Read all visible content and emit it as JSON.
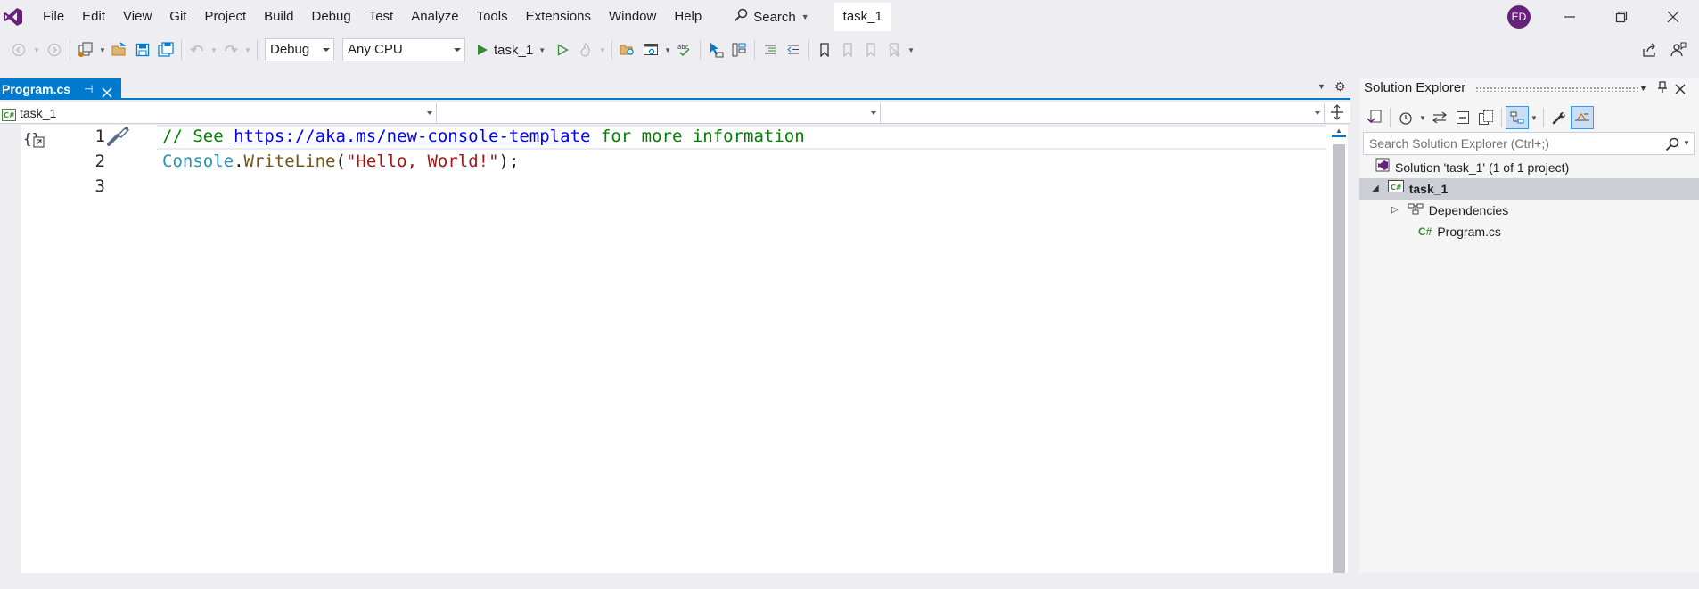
{
  "menu": {
    "items": [
      "File",
      "Edit",
      "View",
      "Git",
      "Project",
      "Build",
      "Debug",
      "Test",
      "Analyze",
      "Tools",
      "Extensions",
      "Window",
      "Help"
    ],
    "search_label": "Search",
    "title_tab": "task_1",
    "avatar_initials": "ED"
  },
  "toolbar": {
    "configuration": "Debug",
    "platform": "Any CPU",
    "run_target": "task_1"
  },
  "document_tab": {
    "label": "Program.cs"
  },
  "navbar": {
    "project": "task_1",
    "type": "",
    "member": ""
  },
  "editor": {
    "line_numbers": [
      "1",
      "2",
      "3"
    ],
    "line1": {
      "comment_prefix": "// See ",
      "link": "https://aka.ms/new-console-template",
      "comment_suffix": " for more information"
    },
    "line2": {
      "type": "Console",
      "dot": ".",
      "method": "WriteLine",
      "open": "(",
      "string": "\"Hello, World!\"",
      "close": ");"
    }
  },
  "solution_explorer": {
    "title": "Solution Explorer",
    "search_placeholder": "Search Solution Explorer (Ctrl+;)",
    "solution_label": "Solution 'task_1' (1 of 1 project)",
    "project_label": "task_1",
    "dependencies_label": "Dependencies",
    "file_label": "Program.cs",
    "csharp_glyph": "C#"
  },
  "colors": {
    "accent": "#007acc",
    "avatar": "#68217a",
    "comment": "#008000",
    "type": "#2b91af",
    "string": "#a31515",
    "link": "#0000ff"
  }
}
